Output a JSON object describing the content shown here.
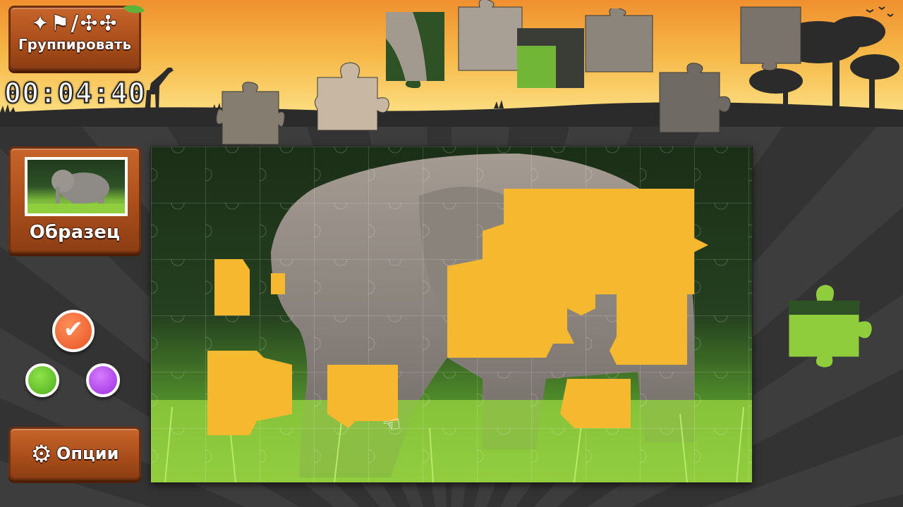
{
  "app": {
    "group_button": {
      "glyph": "✦⚑/✣✣",
      "label": "Группировать"
    },
    "timer": "00:04:40",
    "sample_button": {
      "label": "Образец"
    },
    "options_button": {
      "label": "Опции",
      "icon": "gear-icon"
    },
    "color_choices": [
      {
        "name": "orange",
        "color": "#e85222",
        "selected": true
      },
      {
        "name": "green",
        "color": "#4caf1c",
        "selected": false
      },
      {
        "name": "purple",
        "color": "#9c2ee0",
        "selected": false
      }
    ],
    "board": {
      "empty_slot_color": "#f6b82e",
      "image_subject": "elephant"
    }
  }
}
